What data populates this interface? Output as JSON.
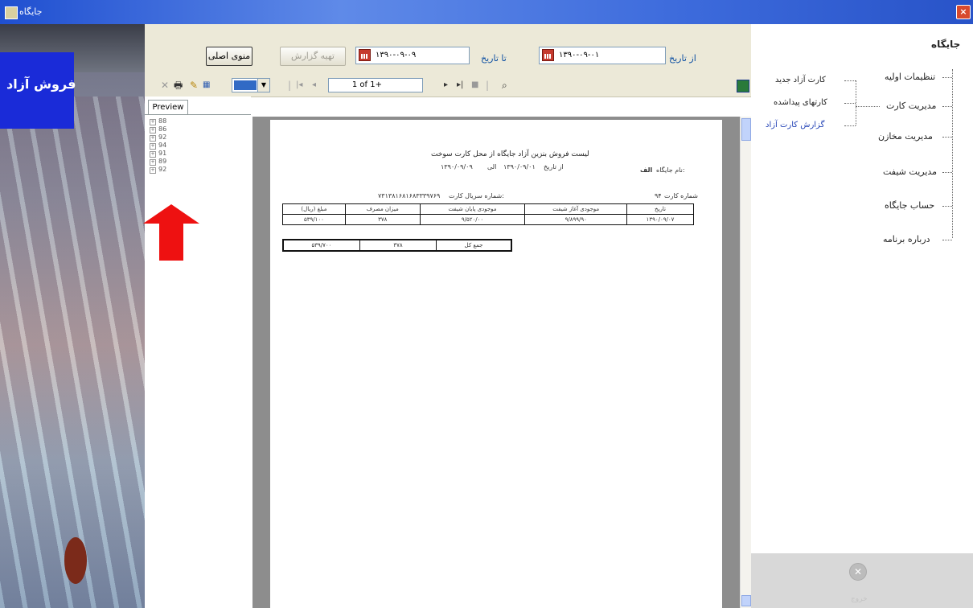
{
  "window": {
    "title": "جایگاه",
    "close": "×"
  },
  "banner": {
    "title": "فروش آزاد"
  },
  "toolbar": {
    "from_label": "از تاریخ",
    "from_date": "۱۳۹۰-۰۹-۰۱",
    "to_label": "تا تاریخ",
    "to_date": "۱۳۹۰-۰۹-۰۹",
    "report_button": "تهیه گزارش",
    "back_button": "منوی اصلی"
  },
  "viewer": {
    "page_text": "1 of 1+",
    "preview_tab": "Preview",
    "tree_items": [
      "88",
      "86",
      "92",
      "94",
      "91",
      "89",
      "92"
    ]
  },
  "report": {
    "title": "لیست فروش بنزین آزاد جایگاه از محل کارت سوخت",
    "date_range_from_label": "از تاریخ",
    "date_from": "۱۳۹۰/۰۹/۰۱",
    "date_range_to_label": "الی",
    "date_to": "۱۳۹۰/۰۹/۰۹",
    "station_label": "نام جایگاه:",
    "station_name": "الف",
    "card_number_label": "شماره کارت",
    "card_number": "۹۴",
    "card_serial_label": "شماره سریال کارت:",
    "card_serial": "۷۳۱۳۸۱۶۸۱۶۸۳۳۳۹۷۶۹",
    "columns": [
      "تاریخ",
      "موجودی آغاز شیفت",
      "موجودی پایان شیفت",
      "میزان مصرف",
      "مبلغ (ریال)"
    ],
    "row": [
      "۱۳۹۰/۰۹/۰۷",
      "۹/۸۹۹/۹۰",
      "۹/۵۲۰/۰۰",
      "۳۷۸",
      "۵۳۹/۱۰۰"
    ],
    "total_label": "جمع کل",
    "total_amount": "۳۷۸",
    "total_price": "۵۳۹/۷۰۰"
  },
  "nav": {
    "title": "جایگاه",
    "items": [
      "تنظیمات اولیه",
      "مدیریت کارت",
      "مدیریت مخازن",
      "مدیریت شیفت",
      "حساب جایگاه",
      "درباره برنامه"
    ],
    "sub_items": [
      "کارت آزاد جدید",
      "کارتهای پیداشده",
      "گزارش کارت آزاد"
    ],
    "exit": "خروج"
  }
}
